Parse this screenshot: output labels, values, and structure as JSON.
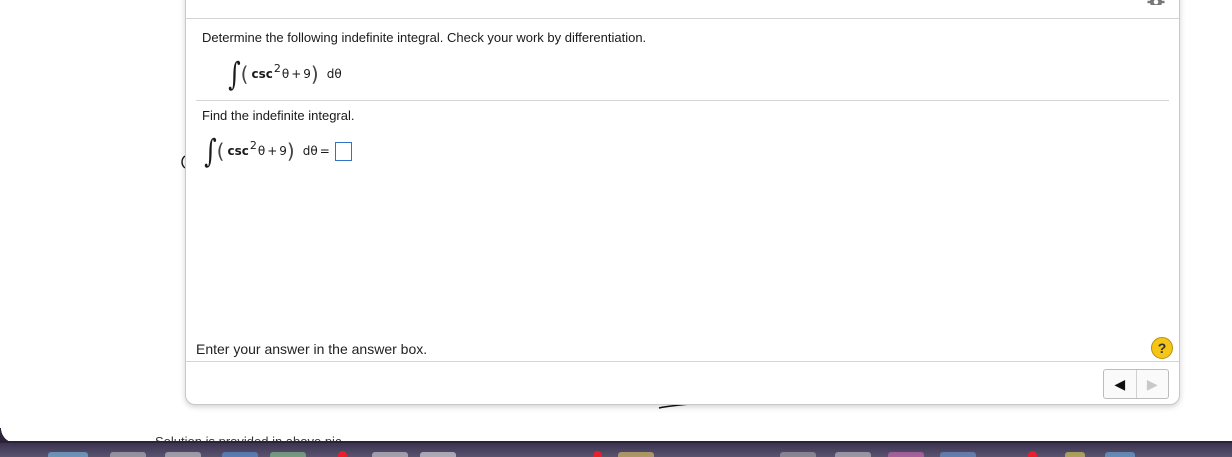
{
  "dialog": {
    "prompt": "Determine the following indefinite integral. Check your work by differentiation.",
    "sub_prompt": "Find the indefinite integral.",
    "instruction": "Enter your answer in the answer box.",
    "help_label": "?",
    "math": {
      "integral": "∫",
      "open_paren": "(",
      "fn": "csc",
      "power": "2",
      "var": "θ",
      "op": "+",
      "constant": "9",
      "close_paren": ")",
      "differential": "dθ",
      "equals": "="
    },
    "nav": {
      "prev": "◀",
      "next": "▶"
    }
  },
  "background": {
    "partial_text": "Solution is provided in above pic"
  },
  "colors": {
    "answer_box_border": "#2f74c9",
    "help_icon": "#f5c518",
    "dock": "#3b3350"
  },
  "icons": [
    "settings-gear-icon",
    "help-icon",
    "previous-arrow-icon",
    "next-arrow-icon"
  ]
}
